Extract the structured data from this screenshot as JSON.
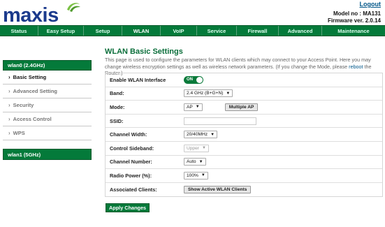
{
  "header": {
    "brand": "maxis",
    "logout": "Logout",
    "model": "Model no : MA131",
    "firmware": "Firmware ver. 2.0.14"
  },
  "nav": [
    "Status",
    "Easy Setup",
    "Setup",
    "WLAN",
    "VoIP",
    "Service",
    "Firewall",
    "Advanced",
    "Maintenance"
  ],
  "nav_active": "WLAN",
  "sidebar": {
    "group1": "wlan0 (2.4GHz)",
    "items": [
      "Basic Setting",
      "Advanced Setting",
      "Security",
      "Access Control",
      "WPS"
    ],
    "active_item": "Basic Setting",
    "group2": "wlan1 (5GHz)"
  },
  "main": {
    "title": "WLAN Basic Settings",
    "description_pre": "This page is used to configure the parameters for WLAN clients which may connect to your Access Point. Here you may change wireless encryption settings as well as wireless network parameters. (If you change the Mode, please ",
    "description_link": "reboot",
    "description_post": " the Router.)",
    "enable_label": "Enable WLAN Interface",
    "enable_value": "ON",
    "band_label": "Band:",
    "band_value": "2.4 GHz (B+G+N)",
    "mode_label": "Mode:",
    "mode_value": "AP",
    "multiple_ap": "Multiple AP",
    "ssid_label": "SSID:",
    "ssid_value": "",
    "channel_width_label": "Channel Width:",
    "channel_width_value": "20/40MHz",
    "sideband_label": "Control Sideband:",
    "sideband_value": "Upper",
    "channel_number_label": "Channel Number:",
    "channel_number_value": "Auto",
    "radio_power_label": "Radio Power (%):",
    "radio_power_value": "100%",
    "clients_label": "Associated Clients:",
    "show_clients": "Show Active WLAN Clients",
    "apply": "Apply Changes"
  },
  "colors": {
    "brand_green": "#047a3a",
    "brand_blue": "#1b3a8c",
    "swirl_green": "#7ac143"
  }
}
